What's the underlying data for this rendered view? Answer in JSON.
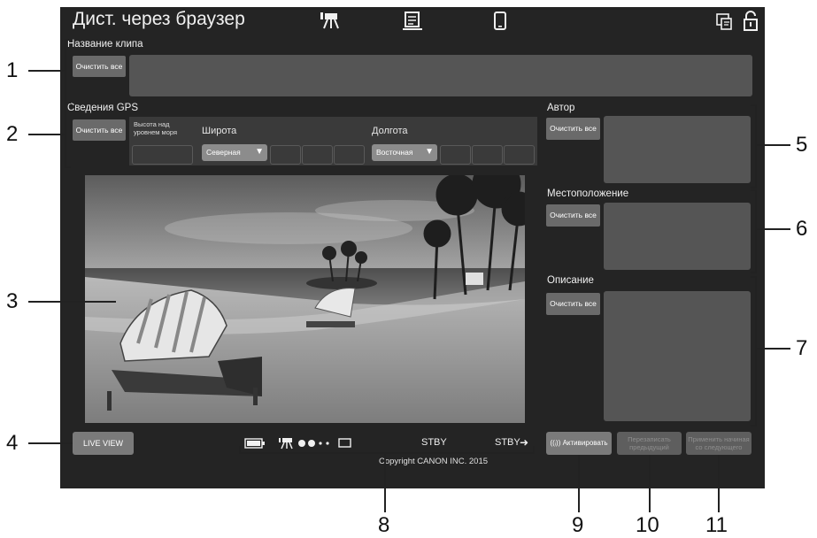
{
  "window": {
    "title": "Дист. через браузер"
  },
  "top_icons": {
    "movie": "movie-camera-icon",
    "metadata": "metadata-icon",
    "phone": "smartphone-icon",
    "remote": "remote-icon",
    "lock": "unlock-icon"
  },
  "clip_name": {
    "label": "Название клипа",
    "clear_label": "Очистить все",
    "value": ""
  },
  "gps": {
    "label": "Сведения GPS",
    "clear_label": "Очистить все",
    "altitude_label": "Высота над уровнем моря",
    "latitude_label": "Широта",
    "latitude_select": "Северная",
    "longitude_label": "Долгота",
    "longitude_select": "Восточная"
  },
  "author": {
    "label": "Автор",
    "clear_label": "Очистить все",
    "value": ""
  },
  "location": {
    "label": "Местоположение",
    "clear_label": "Очистить все",
    "value": ""
  },
  "description": {
    "label": "Описание",
    "clear_label": "Очистить все",
    "value": ""
  },
  "buttons": {
    "live_view": "LIVE VIEW",
    "activate": "Активировать",
    "overwrite_prev": "Перезаписать предыдущий",
    "apply_start_next": "Применить начиная со следующего"
  },
  "status": {
    "stby_left": "STBY",
    "stby_right": "STBY"
  },
  "footer": {
    "copyright": "Copyright CANON INC. 2015"
  },
  "callouts": [
    "1",
    "2",
    "3",
    "4",
    "5",
    "6",
    "7",
    "8",
    "9",
    "10",
    "11"
  ]
}
